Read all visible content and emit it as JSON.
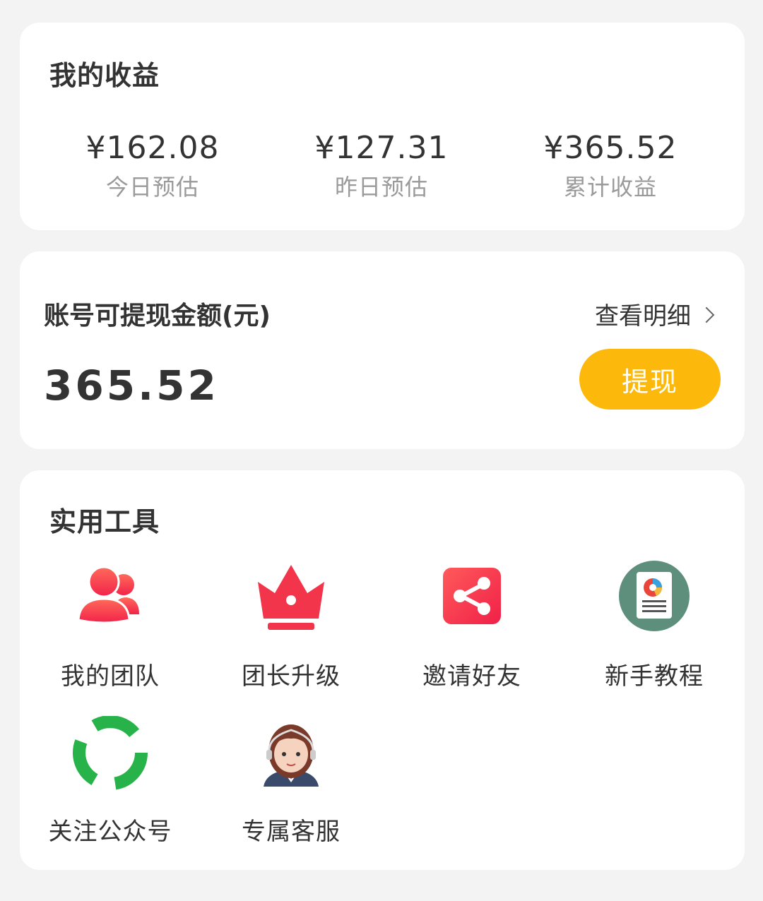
{
  "earnings": {
    "title": "我的收益",
    "stats": [
      {
        "value": "¥162.08",
        "label": "今日预估"
      },
      {
        "value": "¥127.31",
        "label": "昨日预估"
      },
      {
        "value": "¥365.52",
        "label": "累计收益"
      }
    ]
  },
  "balance": {
    "title": "账号可提现金额(元)",
    "detail_label": "查看明细",
    "amount": "365.52",
    "withdraw_label": "提现"
  },
  "tools": {
    "title": "实用工具",
    "items": [
      {
        "label": "我的团队",
        "icon": "team-icon"
      },
      {
        "label": "团长升级",
        "icon": "crown-icon"
      },
      {
        "label": "邀请好友",
        "icon": "share-icon"
      },
      {
        "label": "新手教程",
        "icon": "tutorial-icon"
      },
      {
        "label": "关注公众号",
        "icon": "official-account-icon"
      },
      {
        "label": "专属客服",
        "icon": "customer-service-icon"
      }
    ]
  },
  "colors": {
    "accent": "#fdb80c",
    "icon_red": "#f2354a",
    "icon_green": "#27b34a",
    "background": "#f3f3f3"
  }
}
